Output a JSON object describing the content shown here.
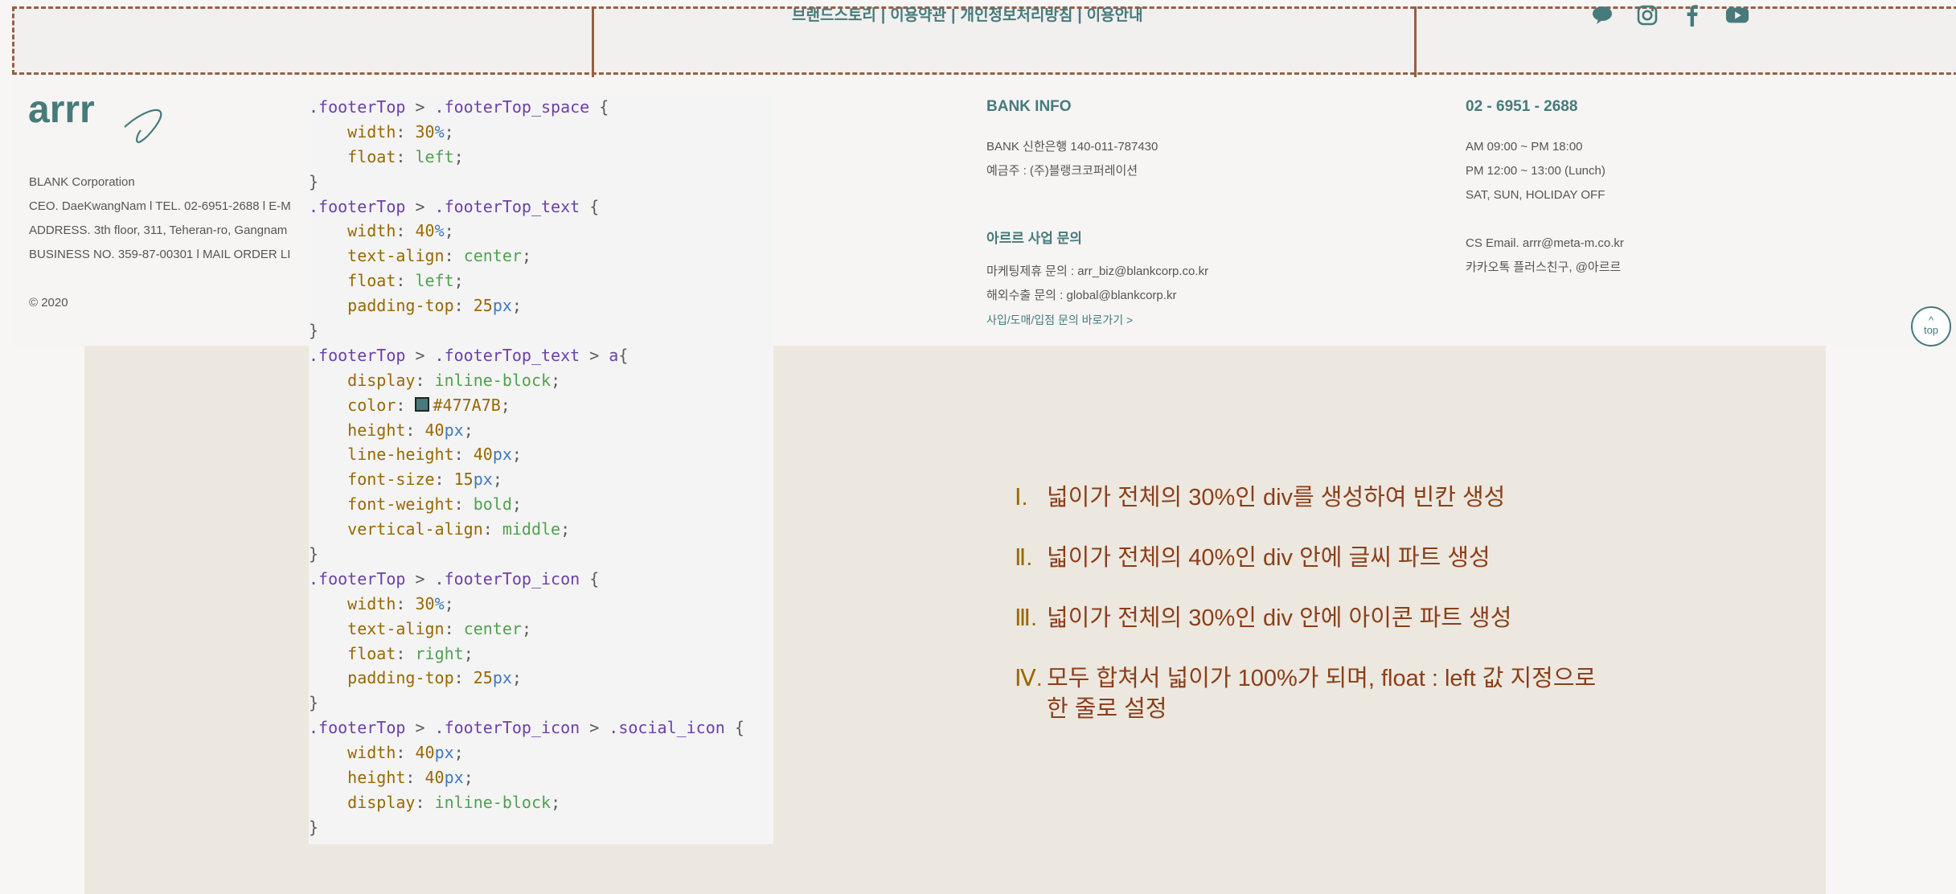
{
  "top_nav": {
    "links": [
      "브랜드스토리",
      "이용약관",
      "개인정보처리방침",
      "이용안내"
    ],
    "separator": "|"
  },
  "social_icons": [
    "speech-bubble-icon",
    "instagram-icon",
    "facebook-icon",
    "youtube-icon"
  ],
  "brand_color": "#477A7B",
  "footer": {
    "logo_text": "arrr",
    "company_lines": [
      "BLANK Corporation",
      "CEO. DaeKwangNam l TEL. 02-6951-2688 l E-M",
      "ADDRESS. 3th floor, 311, Teheran-ro, Gangnam",
      "BUSINESS NO. 359-87-00301 l MAIL ORDER LI"
    ],
    "copyright": "© 2020",
    "bank": {
      "title": "BANK INFO",
      "lines": [
        "BANK 신한은행 140-011-787430",
        "예금주 : (주)블랭크코퍼레이션"
      ]
    },
    "biz": {
      "title": "아르르 사업 문의",
      "lines": [
        "마케팅제휴 문의 : arr_biz@blankcorp.co.kr",
        "해외수출 문의 : global@blankcorp.kr"
      ],
      "link": "사입/도매/입점 문의 바로가기 >"
    },
    "cs": {
      "phone": "02 - 6951 - 2688",
      "hours": [
        "AM 09:00 ~ PM 18:00",
        "PM 12:00 ~ 13:00 (Lunch)",
        "SAT, SUN, HOLIDAY OFF"
      ],
      "contact": [
        "CS Email. arrr@meta-m.co.kr",
        "카카오톡 플러스친구, @아르르"
      ]
    },
    "top_button": "top"
  },
  "notes": [
    {
      "num": "Ⅰ.",
      "text": "넓이가 전체의 30%인 div를 생성하여 빈칸 생성"
    },
    {
      "num": "Ⅱ.",
      "text": "넓이가 전체의 40%인 div 안에 글씨 파트 생성"
    },
    {
      "num": "Ⅲ.",
      "text": "넓이가 전체의 30%인 div 안에 아이콘 파트 생성"
    },
    {
      "num": "Ⅳ.",
      "text": "모두 합쳐서 넓이가 100%가 되며, float : left 값 지정으로 한 줄로 설정"
    }
  ],
  "code_lines": [
    [
      [
        "sel",
        ".footerTop"
      ],
      [
        "pun",
        " > "
      ],
      [
        "sel",
        ".footerTop_space"
      ],
      [
        "pun",
        " {"
      ]
    ],
    [
      [
        "pun",
        "    "
      ],
      [
        "prop",
        "width"
      ],
      [
        "pun",
        ": "
      ],
      [
        "num",
        "30"
      ],
      [
        "unit",
        "%"
      ],
      [
        "pun",
        ";"
      ]
    ],
    [
      [
        "pun",
        "    "
      ],
      [
        "prop",
        "float"
      ],
      [
        "pun",
        ": "
      ],
      [
        "val",
        "left"
      ],
      [
        "pun",
        ";"
      ]
    ],
    [
      [
        "pun",
        "}"
      ]
    ],
    [
      [
        "sel",
        ".footerTop"
      ],
      [
        "pun",
        " > "
      ],
      [
        "sel",
        ".footerTop_text"
      ],
      [
        "pun",
        " {"
      ]
    ],
    [
      [
        "pun",
        "    "
      ],
      [
        "prop",
        "width"
      ],
      [
        "pun",
        ": "
      ],
      [
        "num",
        "40"
      ],
      [
        "unit",
        "%"
      ],
      [
        "pun",
        ";"
      ]
    ],
    [
      [
        "pun",
        "    "
      ],
      [
        "prop",
        "text-align"
      ],
      [
        "pun",
        ": "
      ],
      [
        "val",
        "center"
      ],
      [
        "pun",
        ";"
      ]
    ],
    [
      [
        "pun",
        "    "
      ],
      [
        "prop",
        "float"
      ],
      [
        "pun",
        ": "
      ],
      [
        "val",
        "left"
      ],
      [
        "pun",
        ";"
      ]
    ],
    [
      [
        "pun",
        "    "
      ],
      [
        "prop",
        "padding-top"
      ],
      [
        "pun",
        ": "
      ],
      [
        "num",
        "25"
      ],
      [
        "unit",
        "px"
      ],
      [
        "pun",
        ";"
      ]
    ],
    [
      [
        "pun",
        "}"
      ]
    ],
    [
      [
        "sel",
        ".footerTop"
      ],
      [
        "pun",
        " > "
      ],
      [
        "sel",
        ".footerTop_text"
      ],
      [
        "pun",
        " > "
      ],
      [
        "sel",
        "a"
      ],
      [
        "pun",
        "{"
      ]
    ],
    [
      [
        "pun",
        "    "
      ],
      [
        "prop",
        "display"
      ],
      [
        "pun",
        ": "
      ],
      [
        "val",
        "inline-block"
      ],
      [
        "pun",
        ";"
      ]
    ],
    [
      [
        "pun",
        "    "
      ],
      [
        "prop",
        "color"
      ],
      [
        "pun",
        ": "
      ],
      [
        "swatch",
        ""
      ],
      [
        "num",
        "#477A7B"
      ],
      [
        "pun",
        ";"
      ]
    ],
    [
      [
        "pun",
        "    "
      ],
      [
        "prop",
        "height"
      ],
      [
        "pun",
        ": "
      ],
      [
        "num",
        "40"
      ],
      [
        "unit",
        "px"
      ],
      [
        "pun",
        ";"
      ]
    ],
    [
      [
        "pun",
        "    "
      ],
      [
        "prop",
        "line-height"
      ],
      [
        "pun",
        ": "
      ],
      [
        "num",
        "40"
      ],
      [
        "unit",
        "px"
      ],
      [
        "pun",
        ";"
      ]
    ],
    [
      [
        "pun",
        "    "
      ],
      [
        "prop",
        "font-size"
      ],
      [
        "pun",
        ": "
      ],
      [
        "num",
        "15"
      ],
      [
        "unit",
        "px"
      ],
      [
        "pun",
        ";"
      ]
    ],
    [
      [
        "pun",
        "    "
      ],
      [
        "prop",
        "font-weight"
      ],
      [
        "pun",
        ": "
      ],
      [
        "val",
        "bold"
      ],
      [
        "pun",
        ";"
      ]
    ],
    [
      [
        "pun",
        "    "
      ],
      [
        "prop",
        "vertical-align"
      ],
      [
        "pun",
        ": "
      ],
      [
        "val",
        "middle"
      ],
      [
        "pun",
        ";"
      ]
    ],
    [
      [
        "pun",
        "}"
      ]
    ],
    [
      [
        "sel",
        ".footerTop"
      ],
      [
        "pun",
        " > "
      ],
      [
        "sel",
        ".footerTop_icon"
      ],
      [
        "pun",
        " {"
      ]
    ],
    [
      [
        "pun",
        "    "
      ],
      [
        "prop",
        "width"
      ],
      [
        "pun",
        ": "
      ],
      [
        "num",
        "30"
      ],
      [
        "unit",
        "%"
      ],
      [
        "pun",
        ";"
      ]
    ],
    [
      [
        "pun",
        "    "
      ],
      [
        "prop",
        "text-align"
      ],
      [
        "pun",
        ": "
      ],
      [
        "val",
        "center"
      ],
      [
        "pun",
        ";"
      ]
    ],
    [
      [
        "pun",
        "    "
      ],
      [
        "prop",
        "float"
      ],
      [
        "pun",
        ": "
      ],
      [
        "val",
        "right"
      ],
      [
        "pun",
        ";"
      ]
    ],
    [
      [
        "pun",
        "    "
      ],
      [
        "prop",
        "padding-top"
      ],
      [
        "pun",
        ": "
      ],
      [
        "num",
        "25"
      ],
      [
        "unit",
        "px"
      ],
      [
        "pun",
        ";"
      ]
    ],
    [
      [
        "pun",
        "}"
      ]
    ],
    [
      [
        "sel",
        ".footerTop"
      ],
      [
        "pun",
        " > "
      ],
      [
        "sel",
        ".footerTop_icon"
      ],
      [
        "pun",
        " > "
      ],
      [
        "sel",
        ".social_icon"
      ],
      [
        "pun",
        " {"
      ]
    ],
    [
      [
        "pun",
        "    "
      ],
      [
        "prop",
        "width"
      ],
      [
        "pun",
        ": "
      ],
      [
        "num",
        "40"
      ],
      [
        "unit",
        "px"
      ],
      [
        "pun",
        ";"
      ]
    ],
    [
      [
        "pun",
        "    "
      ],
      [
        "prop",
        "height"
      ],
      [
        "pun",
        ": "
      ],
      [
        "num",
        "40"
      ],
      [
        "unit",
        "px"
      ],
      [
        "pun",
        ";"
      ]
    ],
    [
      [
        "pun",
        "    "
      ],
      [
        "prop",
        "display"
      ],
      [
        "pun",
        ": "
      ],
      [
        "val",
        "inline-block"
      ],
      [
        "pun",
        ";"
      ]
    ],
    [
      [
        "pun",
        "}"
      ]
    ]
  ]
}
